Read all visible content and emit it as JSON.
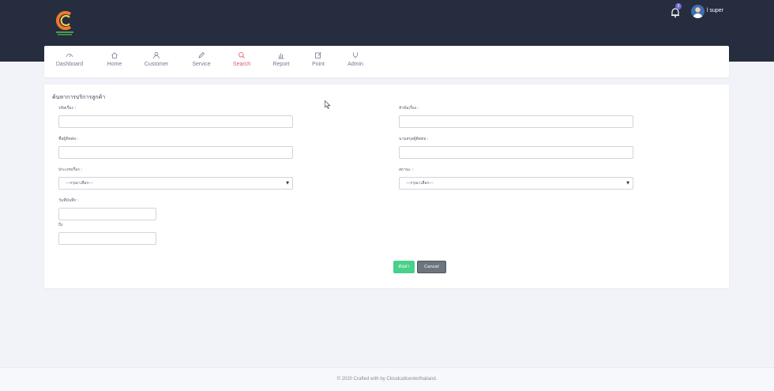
{
  "header": {
    "notification_count": "3",
    "user_name": "l super"
  },
  "nav": {
    "items": [
      {
        "label": "Dashboard",
        "icon": "gauge-icon"
      },
      {
        "label": "Home",
        "icon": "home-icon"
      },
      {
        "label": "Customer",
        "icon": "user-icon"
      },
      {
        "label": "Service",
        "icon": "pen-icon"
      },
      {
        "label": "Search",
        "icon": "search-icon",
        "active": true
      },
      {
        "label": "Report",
        "icon": "bar-chart-icon"
      },
      {
        "label": "Point",
        "icon": "edit-icon"
      },
      {
        "label": "Admin",
        "icon": "shield-icon"
      }
    ]
  },
  "form": {
    "title": "ค้นหาการบริการลูกค้า",
    "fields": {
      "ticket_no": {
        "label": "รหัสเรื่อง :",
        "value": ""
      },
      "subject": {
        "label": "หัวข้อเรื่อง :",
        "value": ""
      },
      "contact_first": {
        "label": "ชื่อผู้ติดต่อ :",
        "value": ""
      },
      "contact_last": {
        "label": "นามสกุลผู้ติดต่อ :",
        "value": ""
      },
      "type": {
        "label": "ประเภทเรื่อง :",
        "selected": "---กรุณาเลือก---"
      },
      "status": {
        "label": "สถานะ :",
        "selected": "---กรุณาเลือก---"
      },
      "date_from": {
        "label": "วันที่บันทึก :",
        "value": ""
      },
      "date_to": {
        "label": "ถึง",
        "value": ""
      }
    },
    "search_button": "ค้นหา",
    "cancel_button": "Cancel"
  },
  "footer": {
    "text": "© 2020 Crafted with by Cloudcallcenterthailand."
  },
  "colors": {
    "topbar": "#262d3f",
    "active_nav": "#e1596b",
    "search_button": "#48d18a",
    "cancel_button": "#6c757d",
    "badge": "#6f6ad8"
  }
}
